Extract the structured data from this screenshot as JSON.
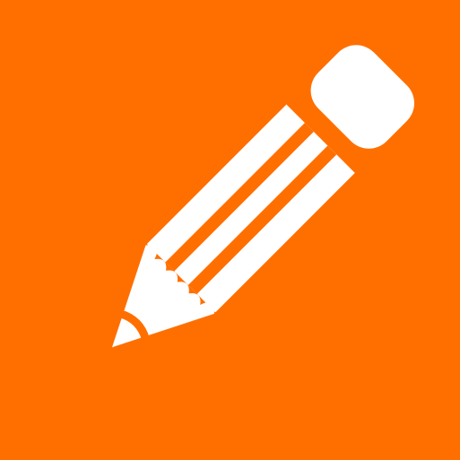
{
  "icon": {
    "name": "pencil-icon",
    "foreground": "#FFFFFF",
    "background": "#FF6F00"
  }
}
